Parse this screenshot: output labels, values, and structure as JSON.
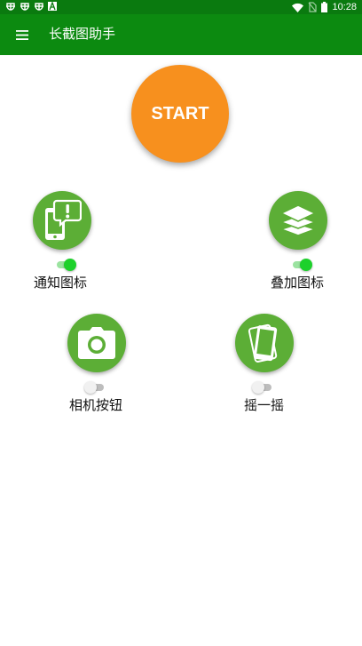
{
  "status_bar": {
    "time": "10:28",
    "left_icons": [
      "debug-icon",
      "debug-icon",
      "debug-icon",
      "a-icon"
    ],
    "right_icons": [
      "wifi-icon",
      "no-sim-icon",
      "battery-icon"
    ]
  },
  "toolbar": {
    "menu_icon": "hamburger-menu-icon",
    "title": "长截图助手",
    "color": "#0c8a10"
  },
  "start_button": {
    "label": "START",
    "color": "#f7901e"
  },
  "features": {
    "notification_icon": {
      "label": "通知图标",
      "icon": "phone-alert-icon",
      "enabled": true
    },
    "overlay_icon": {
      "label": "叠加图标",
      "icon": "layers-icon",
      "enabled": true
    },
    "camera_button": {
      "label": "相机按钮",
      "icon": "camera-icon",
      "enabled": false
    },
    "shake": {
      "label": "摇一摇",
      "icon": "shake-phone-icon",
      "enabled": false
    }
  },
  "colors": {
    "feature_green": "#5cae36",
    "toggle_on": "#1dd12b",
    "status_bar": "#0a7a0f"
  }
}
